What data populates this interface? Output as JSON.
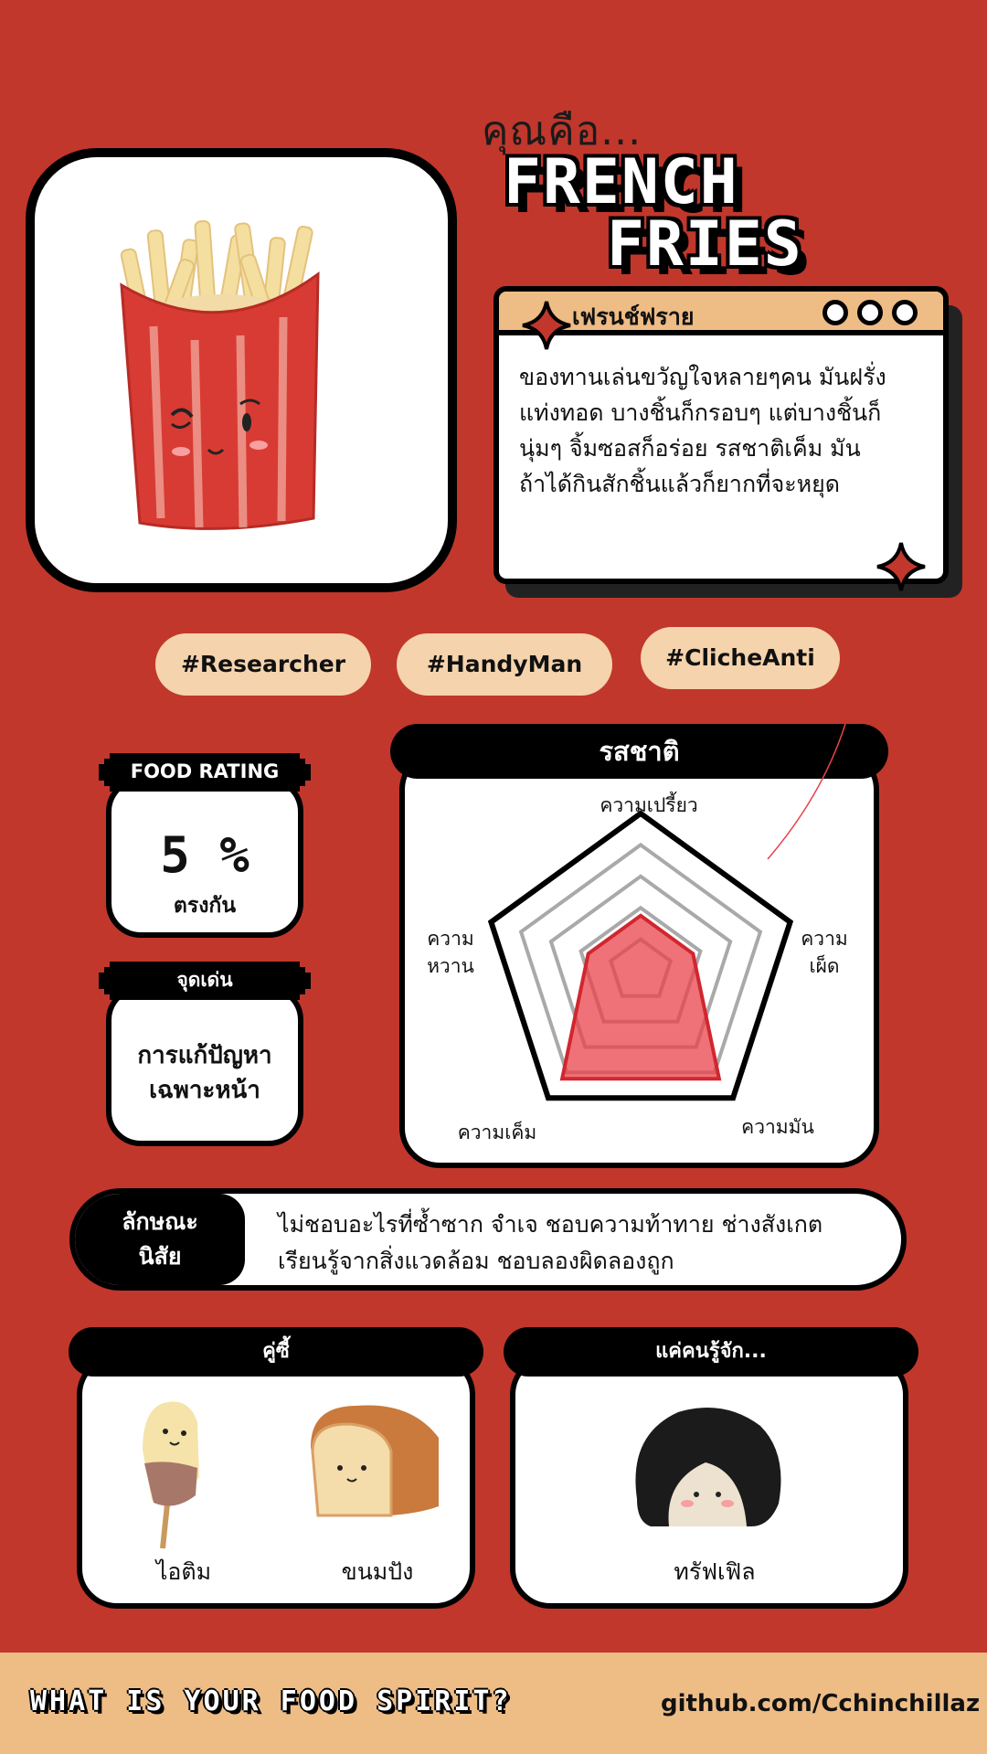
{
  "header": {
    "you_are": "คุณคือ...",
    "title_line1": "FRENCH",
    "title_line2": "FRIES"
  },
  "description_window": {
    "title": "เฟรนช์ฟราย",
    "text_lines": [
      "ของทานเล่นขวัญใจหลายๆคน มันฝรั่ง",
      "แท่งทอด บางชิ้นก็กรอบๆ แต่บางชิ้นก็",
      "นุ่มๆ จิ้มซอสก็อร่อย รสชาติเค็ม มัน",
      "ถ้าได้กินสักชิ้นแล้วก็ยากที่จะหยุด"
    ]
  },
  "tags": [
    "#Researcher",
    "#HandyMan",
    "#ClicheAnti"
  ],
  "food_rating": {
    "label": "FOOD RATING",
    "value": "5 %",
    "subtext": "ตรงกัน"
  },
  "highlight": {
    "label": "จุดเด่น",
    "line1": "การแก้ปัญหา",
    "line2": "เฉพาะหน้า"
  },
  "taste": {
    "title": "รสชาติ",
    "axes": {
      "sour": "ความเปรี้ยว",
      "spicy_line1": "ความ",
      "spicy_line2": "เผ็ด",
      "oily": "ความมัน",
      "salty": "ความเค็ม",
      "sweet_line1": "ความ",
      "sweet_line2": "หวาน"
    },
    "levels": {
      "sour": 0.35,
      "spicy": 0.35,
      "oily": 0.85,
      "salty": 0.85,
      "sweet": 0.35
    },
    "fill_color": "#e8434b"
  },
  "personality": {
    "label_line1": "ลักษณะ",
    "label_line2": "นิสัย",
    "line1": "ไม่ชอบอะไรที่ซ้ำซาก จำเจ ชอบความท้าทาย ช่างสังเกต",
    "line2": "เรียนรู้จากสิ่งแวดล้อม ชอบลองผิดลองถูก"
  },
  "pair": {
    "title": "คู่ซี้",
    "items": [
      "ไอติม",
      "ขนมปัง"
    ]
  },
  "known": {
    "title": "แค่คนรู้จัก...",
    "items": [
      "ทรัฟเฟิล"
    ]
  },
  "footer": {
    "left": "WHAT IS YOUR FOOD SPIRIT?",
    "right": "github.com/Cchinchillaz"
  },
  "colors": {
    "background": "#c1372c",
    "accent": "#eebc85",
    "tag": "#f5d3ac"
  }
}
